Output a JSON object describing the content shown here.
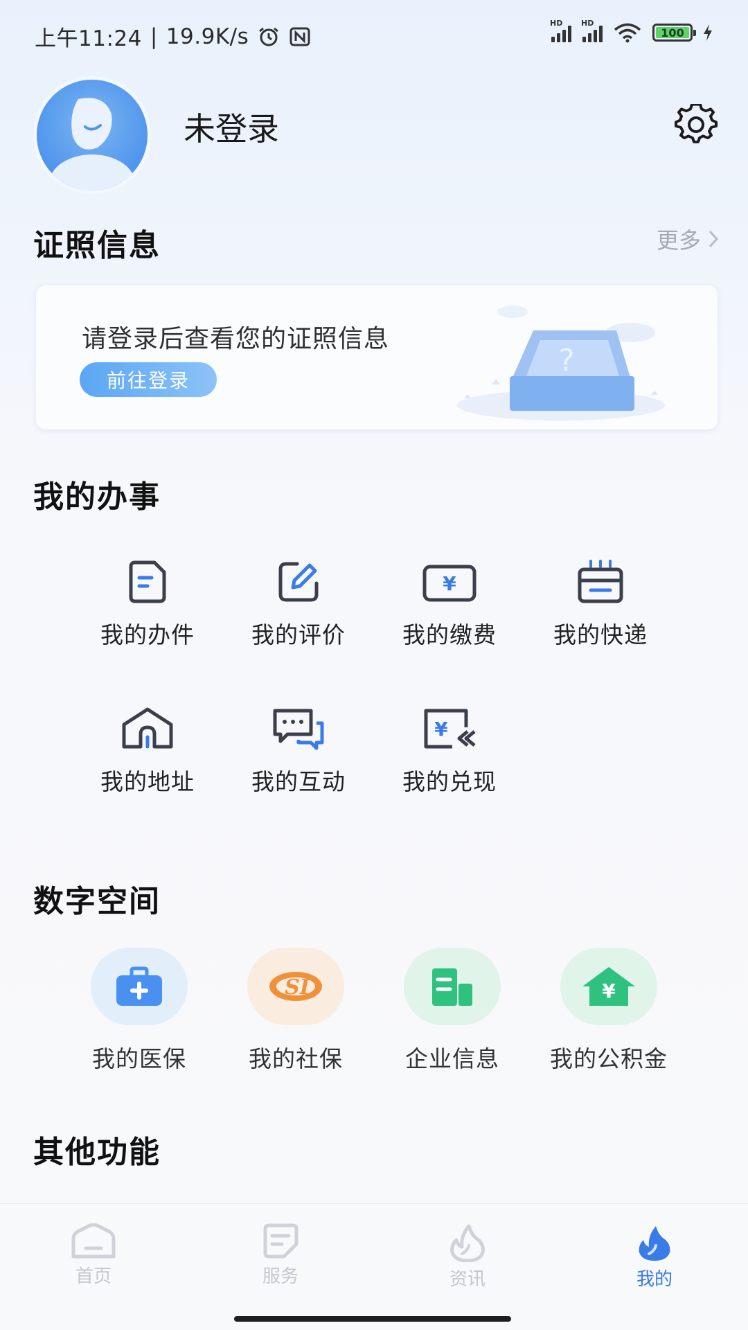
{
  "status_bar": {
    "time": "上午11:24",
    "separator": "|",
    "speed": "19.9K/s",
    "battery": "100",
    "sim_label": "HD"
  },
  "profile": {
    "username": "未登录"
  },
  "certificate": {
    "title": "证照信息",
    "more": "更多",
    "message": "请登录后查看您的证照信息",
    "login_button": "前往登录"
  },
  "my_affairs": {
    "title": "我的办事",
    "items": [
      {
        "label": "我的办件",
        "icon": "document-icon"
      },
      {
        "label": "我的评价",
        "icon": "edit-icon"
      },
      {
        "label": "我的缴费",
        "icon": "payment-icon"
      },
      {
        "label": "我的快递",
        "icon": "express-box-icon"
      },
      {
        "label": "我的地址",
        "icon": "home-address-icon"
      },
      {
        "label": "我的互动",
        "icon": "chat-icon"
      },
      {
        "label": "我的兑现",
        "icon": "cash-redeem-icon"
      }
    ]
  },
  "digital_space": {
    "title": "数字空间",
    "items": [
      {
        "label": "我的医保",
        "icon": "medical-kit-icon",
        "color": "#4a90f0",
        "bg": "#e3eefb"
      },
      {
        "label": "我的社保",
        "icon": "social-security-icon",
        "color": "#f0913a",
        "bg": "#fbece0"
      },
      {
        "label": "企业信息",
        "icon": "building-icon",
        "color": "#2ec27e",
        "bg": "#e1f4ea"
      },
      {
        "label": "我的公积金",
        "icon": "housing-fund-icon",
        "color": "#2ec27e",
        "bg": "#e1f4ea"
      }
    ]
  },
  "other": {
    "title": "其他功能"
  },
  "bottom_nav": {
    "items": [
      {
        "label": "首页",
        "icon": "home-icon"
      },
      {
        "label": "服务",
        "icon": "service-icon"
      },
      {
        "label": "资讯",
        "icon": "flame-icon"
      },
      {
        "label": "我的",
        "icon": "flame-filled-icon"
      }
    ],
    "active": "我的"
  },
  "colors": {
    "accent": "#3a7be8",
    "icon_dark": "#3a3f4b",
    "inactive": "#c4c7cd"
  }
}
